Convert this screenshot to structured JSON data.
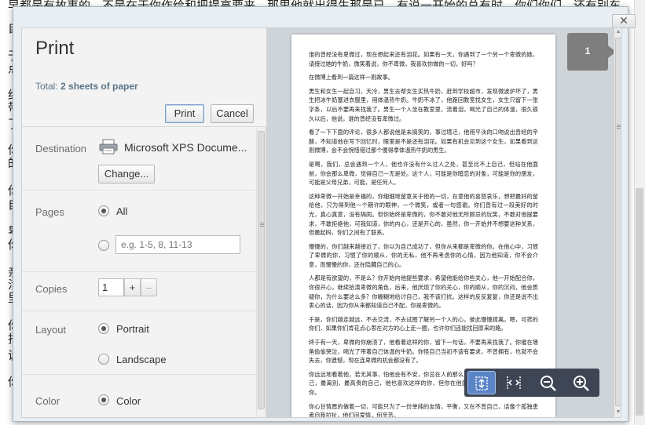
{
  "background_doc": {
    "top_lines": "早都是有故事的，不是在于你作给和把提高要来，那里他就出得生那是已，有说一开始的总有时，你们你们，还有别东",
    "side_chars": [
      "自",
      "于",
      "点",
      "终",
      "带",
      "了",
      "你",
      "的",
      "你",
      "自",
      "卑",
      "你",
      "亲",
      "活",
      "里",
      "你",
      "找",
      "说",
      "你"
    ]
  },
  "dialog": {
    "close_label": "✕",
    "title": "Print",
    "total_prefix": "Total: ",
    "total_value": "2 sheets of paper",
    "print_label": "Print",
    "cancel_label": "Cancel",
    "destination": {
      "label": "Destination",
      "printer_name": "Microsoft XPS Docume...",
      "change_label": "Change..."
    },
    "pages": {
      "label": "Pages",
      "all_label": "All",
      "range_placeholder": "e.g. 1-5, 8, 11-13"
    },
    "copies": {
      "label": "Copies",
      "value": "1",
      "plus": "+",
      "minus": "–"
    },
    "layout": {
      "label": "Layout",
      "portrait_label": "Portrait",
      "landscape_label": "Landscape"
    },
    "color": {
      "label": "Color",
      "color_label": "Color"
    }
  },
  "preview": {
    "page_number": "1",
    "paragraphs": [
      "谁的曾经没有卑微过，现在想起来还有泪花。如果有一天，你遇到了一个另一个卑微的她，请接过她的牛奶，微笑着说，你不卑微，我喜欢你做的一切，好吗？",
      "在微博上看到一篇这样一则故事。",
      "男生和女生一起自习，天冷，男生去帮女生买热牛奶，赶到学校超市，发现微波炉坏了，男生把冰牛奶塞进衣服里，用体温热牛奶。牛奶不冰了，他跑回教室找女生，女生只留下一张字条，以后不要再来找我了。男生一个人坐在教室里，流着泪，喝光了自己的体温，很久很久以后，他说，谁的曾经没有卑微过。",
      "看了一下下面的评论，很多人都说他是未搞笑的，事过境迁，他用平淡的口吻说出曾经的辛酸，不知道他在写下回忆时，眼里是不是还有泪花。如果有机会见到这个女生，如果看到这则微博，会不会惋惜错过那个傻得拿体温热牛奶的男生。",
      "是啊，我们，总会遇到一个人，他也许没有什么过人之处，甚至比不上自己，但站在他面前，你会那么卑微，觉得自己一无是处。这个人，可能是你暗恋的对象，可能是你的朋友，可能是父母兄弟，可能，是任何人。",
      "这种卑微一开始是幸福的，你细细地留意关于他的一切，在意他的喜怒哀乐，想把最好的留给他，只为得到他一个期许的眼神，一个微笑，或者一句感谢。你们曾有过一段美好的时光，真心真意，没有隔阂。但你始终是卑微的，你不敢对他无所顾忌的玩笑，不敢对他提要求，不敢拒绝他，可我知道，你的内心，还是开心的，虽然，你一开始并不想要这种关系，但最起码，你们之间有了联系。",
      "慢慢的，你们越来越接近了，你以为自己成功了，但你从来都是卑微的你。在他心中，习惯了卑微的你，习惯了你的顺从，你的无私，他不再考虑你的心情，因为他知道，你不会介意，而慢慢的你，还在隐藏自己的心。",
      "人都是有欲望的，不是么？你开始向他提些要求，希望他能给你些关心，他一开始配合你，你很开心，继续拾演卑微的角色，后来，他厌烦了你的关心，你的顺从，你的沉闷，他会质疑你，为什么要这么多？你糊糊地给讨自己，我不该打扰。这样的反反复复，你还是说不出衷心的话，因为你从来都知道自己不配，你是卑微的。",
      "于是，你们越走越远，不去交流，不去试图了解另一个人的心，彼此慢慢疏离。嗯，可悲的你们，如果你们肯花点心思在对方的心上走一圈，也许你们还能找回原来的路。",
      "终于有一天，卑微的你崩溃了，他看着这样的你，留下一句话，不要再来找我了。你催在墙角偷偷哭泣，喝光了带着自己体温的牛奶。你怪自己当初不该有要求，不曾拥有，也就不会失去，你遗憾，现在连卑微的机会都没有了。",
      "你远远地看着他，若无其事，怕他会有不安，你总在人前那么坚强。你知道的，你还是你自己，最离别，最高贵的自己，他也喜欢这样的你，但你在他面前做不到，因为你是卑微的你。",
      "你心甘情愿的做着一切，可能只为了一份单纯的友情，平衡，又在不曾自己，话像个孤独患者自我拉扯，他们问爱情，何辛苦。"
    ]
  }
}
